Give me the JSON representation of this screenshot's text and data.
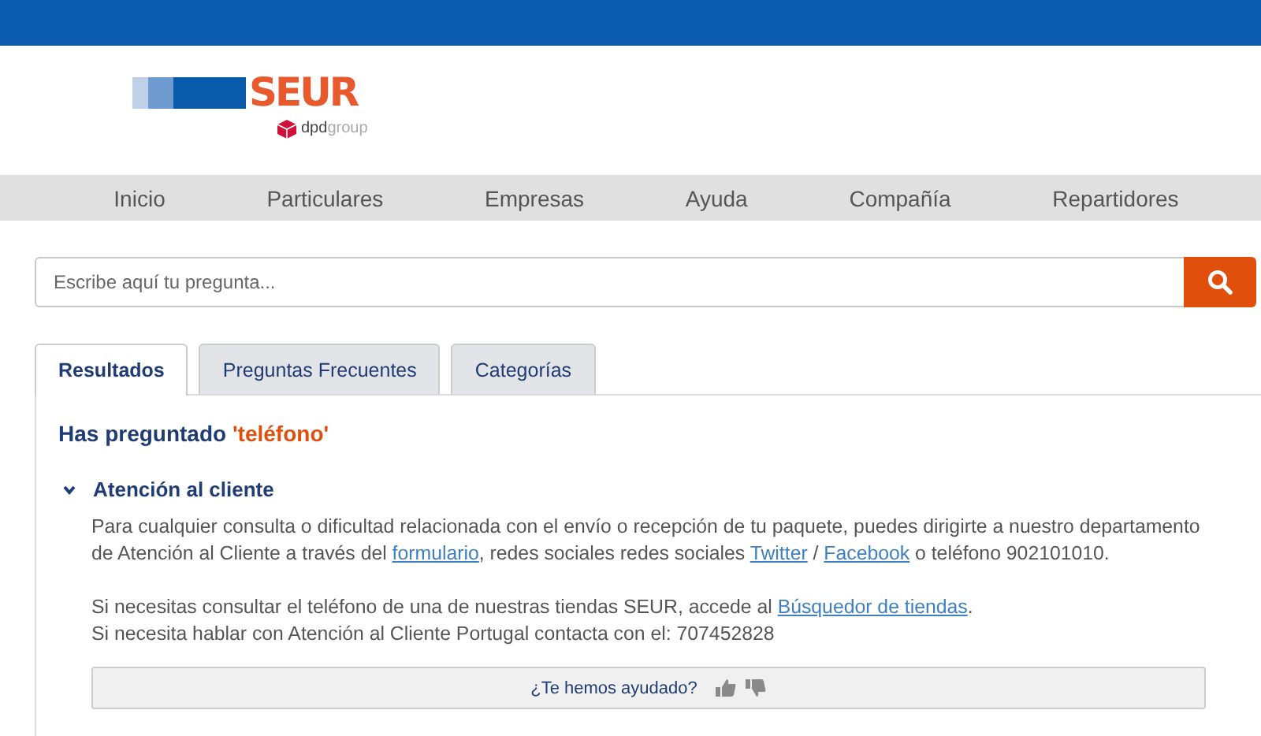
{
  "logo": {
    "brand": "SEUR",
    "sub_bold": "dpd",
    "sub_light": "group"
  },
  "nav": [
    "Inicio",
    "Particulares",
    "Empresas",
    "Ayuda",
    "Compañía",
    "Repartidores"
  ],
  "search": {
    "placeholder": "Escribe aquí tu pregunta..."
  },
  "tabs": [
    {
      "label": "Resultados",
      "selected": true
    },
    {
      "label": "Preguntas Frecuentes",
      "selected": false
    },
    {
      "label": "Categorías",
      "selected": false
    }
  ],
  "query": {
    "label": "Has preguntado",
    "term": "'teléfono'"
  },
  "answers": [
    {
      "title": "Atención al cliente",
      "expanded": true,
      "paragraphs": [
        [
          {
            "kind": "text",
            "text": "Para cualquier consulta o dificultad relacionada con el envío o recepción de tu paquete, puedes dirigirte a nuestro departamento de Atención al Cliente a través del "
          },
          {
            "kind": "link",
            "text": "formulario"
          },
          {
            "kind": "text",
            "text": ", redes sociales redes sociales "
          },
          {
            "kind": "link",
            "text": "Twitter"
          },
          {
            "kind": "text",
            "text": " / "
          },
          {
            "kind": "link",
            "text": "Facebook"
          },
          {
            "kind": "text",
            "text": " o teléfono 902101010."
          }
        ],
        [
          {
            "kind": "text",
            "text": "Si necesitas consultar el teléfono de una de nuestras tiendas SEUR, accede al "
          },
          {
            "kind": "link",
            "text": "Búsquedor de tiendas"
          },
          {
            "kind": "text",
            "text": "."
          }
        ],
        [
          {
            "kind": "text",
            "text": "Si necesita hablar con Atención al Cliente Portugal contacta con el: 707452828"
          }
        ]
      ],
      "feedback": "¿Te hemos ayudado?"
    }
  ]
}
